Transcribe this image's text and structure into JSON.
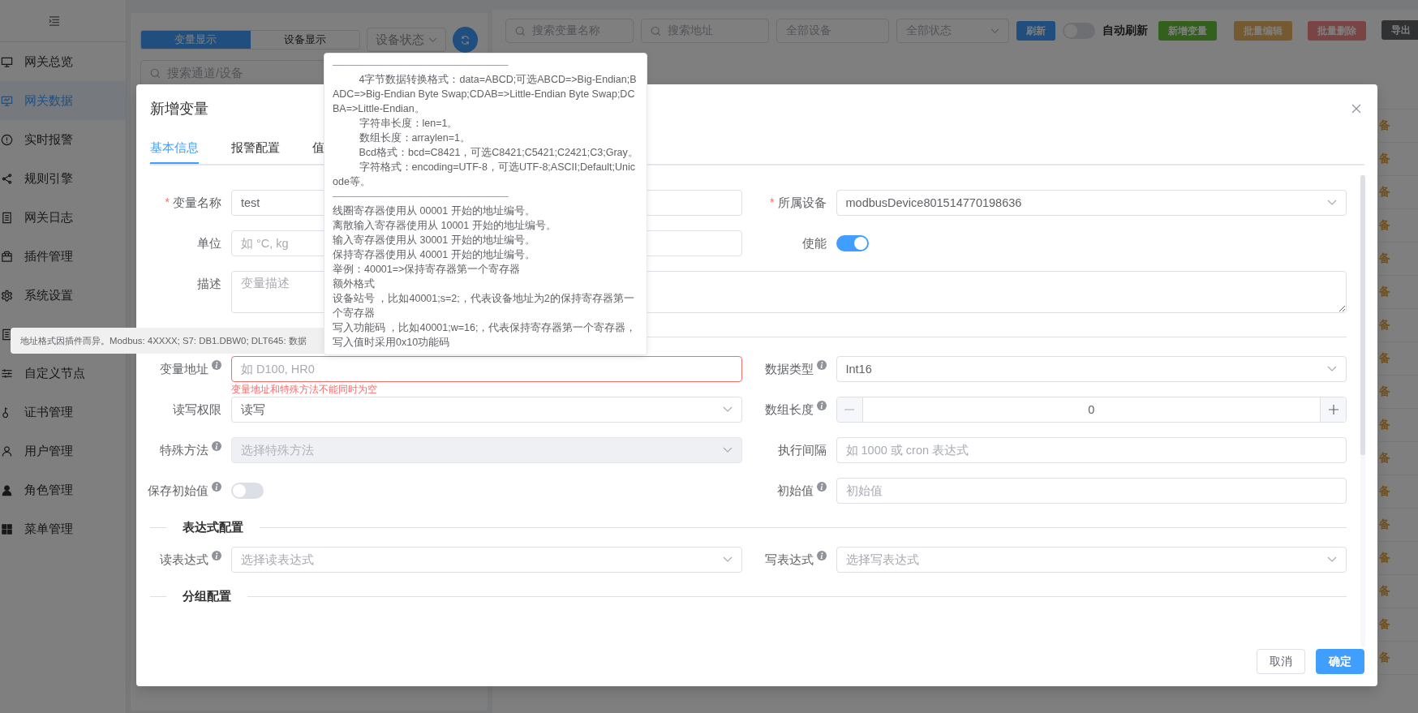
{
  "sidebar": {
    "items": [
      {
        "label": "网关总览",
        "selected": false
      },
      {
        "label": "网关数据",
        "selected": true
      },
      {
        "label": "实时报警",
        "selected": false
      },
      {
        "label": "规则引擎",
        "selected": false
      },
      {
        "label": "网关日志",
        "selected": false
      },
      {
        "label": "插件管理",
        "selected": false
      },
      {
        "label": "系统设置",
        "selected": false
      },
      {
        "selected": false
      },
      {
        "label": "自定义节点",
        "selected": false
      },
      {
        "label": "证书管理",
        "selected": false
      },
      {
        "label": "用户管理",
        "selected": false
      },
      {
        "label": "角色管理",
        "selected": false
      },
      {
        "label": "菜单管理",
        "selected": false
      }
    ]
  },
  "channel_panel": {
    "view_tabs": [
      {
        "label": "变量显示",
        "selected": true
      },
      {
        "label": "设备显示",
        "selected": false
      }
    ],
    "status_select": {
      "value": "设备状态"
    },
    "search": {
      "placeholder": "搜索通道/设备"
    }
  },
  "variable_panel": {
    "toolbar": {
      "name_search": {
        "placeholder": "搜索变量名称"
      },
      "address_search": {
        "placeholder": "搜索地址"
      },
      "device_select": {
        "placeholder": "全部设备"
      },
      "status_select": {
        "placeholder": "全部状态"
      },
      "refresh_button": {
        "label": "刷新"
      },
      "auto_refresh": {
        "label": "自动刷新",
        "on": false
      },
      "buttons": [
        {
          "label": "新增变量",
          "kind": "success",
          "disabled": false
        },
        {
          "label": "批量编辑",
          "kind": "warning",
          "disabled": true
        },
        {
          "label": "批量删除",
          "kind": "danger",
          "disabled": true
        },
        {
          "label": "导出",
          "kind": "info",
          "disabled": false
        }
      ]
    },
    "table": {
      "rows": [
        {
          "column_1": "备"
        },
        {
          "column_1": "备"
        },
        {
          "column_1": "备"
        },
        {
          "column_1": "备"
        },
        {
          "column_1": "备"
        },
        {
          "column_1": "备"
        },
        {
          "column_1": "备"
        },
        {
          "column_1": "备"
        },
        {
          "column_1": "备"
        },
        {
          "column_1": "备"
        },
        {
          "column_1": "备"
        },
        {
          "column_1": "备"
        },
        {
          "column_1": "备"
        },
        {
          "column_1": "备"
        },
        {
          "column_1": "备"
        },
        {
          "column_1": "备"
        },
        {
          "column_1": "备"
        }
      ]
    }
  },
  "dialog": {
    "title": "新增变量",
    "required_mark": "*",
    "tabs": [
      {
        "label": "基本信息",
        "selected": true
      },
      {
        "label": "报警配置",
        "selected": false
      },
      {
        "label": "值",
        "selected": false
      }
    ],
    "form": [
      {
        "kind": "pair",
        "cells": [
          {
            "label": "变量名称",
            "required": true,
            "kind": "input",
            "value": "test"
          },
          {
            "label": "所属设备",
            "required": true,
            "kind": "select",
            "value": "modbusDevice801514770198636"
          }
        ]
      },
      {
        "kind": "pair",
        "cells": [
          {
            "label": "单位",
            "kind": "input",
            "placeholder": "如 °C, kg"
          },
          {
            "label": "使能",
            "kind": "switch",
            "on": true
          }
        ]
      },
      {
        "kind": "full",
        "cells": [
          {
            "label": "描述",
            "kind": "textarea",
            "placeholder": "变量描述"
          }
        ]
      },
      {
        "kind": "section"
      },
      {
        "kind": "pair",
        "cells": [
          {
            "label": "变量地址",
            "info": true,
            "kind": "input",
            "placeholder": "如 D100, HR0",
            "error": "变量地址和特殊方法不能同时为空"
          },
          {
            "label": "数据类型",
            "info": true,
            "kind": "select",
            "value": "Int16"
          }
        ]
      },
      {
        "kind": "pair",
        "cells": [
          {
            "label": "读写权限",
            "kind": "select",
            "value": "读写"
          },
          {
            "label": "数组长度",
            "info": true,
            "kind": "number",
            "value": "0"
          }
        ]
      },
      {
        "kind": "pair",
        "cells": [
          {
            "label": "特殊方法",
            "info": true,
            "kind": "select",
            "placeholder": "选择特殊方法",
            "disabled": true
          },
          {
            "label": "执行间隔",
            "kind": "input",
            "placeholder": "如 1000 或 cron 表达式"
          }
        ]
      },
      {
        "kind": "pair",
        "cells": [
          {
            "label": "保存初始值",
            "info": true,
            "kind": "switch",
            "on": false
          },
          {
            "label": "初始值",
            "info": true,
            "kind": "input",
            "placeholder": "初始值"
          }
        ]
      },
      {
        "kind": "section",
        "title": "表达式配置"
      },
      {
        "kind": "pair",
        "cells": [
          {
            "label": "读表达式",
            "info": true,
            "kind": "select",
            "placeholder": "选择读表达式"
          },
          {
            "label": "写表达式",
            "info": true,
            "kind": "select",
            "placeholder": "选择写表达式"
          }
        ]
      },
      {
        "kind": "section",
        "title": "分组配置"
      }
    ],
    "buttons": [
      {
        "label": "取消",
        "kind": "default"
      },
      {
        "label": "确定",
        "kind": "primary"
      }
    ]
  },
  "address_tooltip": {
    "text": "地址格式因插件而异。Modbus: 4XXXX; S7: DB1.DBW0; DLT645: 数据"
  },
  "format_tooltip": {
    "lines": [
      {
        "kind": "rule",
        "text": "——————————————————"
      },
      {
        "kind": "indent",
        "text": "4字节数据转换格式：data=ABCD;可选ABCD=>Big-Endian;BADC=>Big-Endian Byte Swap;CDAB=>Little-Endian Byte Swap;DCBA=>Little-Endian。"
      },
      {
        "kind": "indent",
        "text": "字符串长度：len=1。"
      },
      {
        "kind": "indent",
        "text": "数组长度：arraylen=1。"
      },
      {
        "kind": "indent",
        "text": "Bcd格式：bcd=C8421，可选C8421;C5421;C2421;C3;Gray。"
      },
      {
        "kind": "indent",
        "text": "字符格式：encoding=UTF-8，可选UTF-8;ASCII;Default;Unicode等。"
      },
      {
        "kind": "rule",
        "text": "——————————————————"
      },
      {
        "kind": "plain",
        "text": "线圈寄存器使用从 00001 开始的地址编号。"
      },
      {
        "kind": "plain",
        "text": "离散输入寄存器使用从 10001 开始的地址编号。"
      },
      {
        "kind": "plain",
        "text": "输入寄存器使用从 30001 开始的地址编号。"
      },
      {
        "kind": "plain",
        "text": "保持寄存器使用从 40001 开始的地址编号。"
      },
      {
        "kind": "plain",
        "text": "举例：40001=>保持寄存器第一个寄存器"
      },
      {
        "kind": "plain",
        "text": "额外格式"
      },
      {
        "kind": "plain",
        "text": "设备站号 ，比如40001;s=2;，代表设备地址为2的保持寄存器第一个寄存器"
      },
      {
        "kind": "plain",
        "text": "写入功能码 ，比如40001;w=16;，代表保持寄存器第一个寄存器，写入值时采用0x10功能码"
      }
    ]
  }
}
